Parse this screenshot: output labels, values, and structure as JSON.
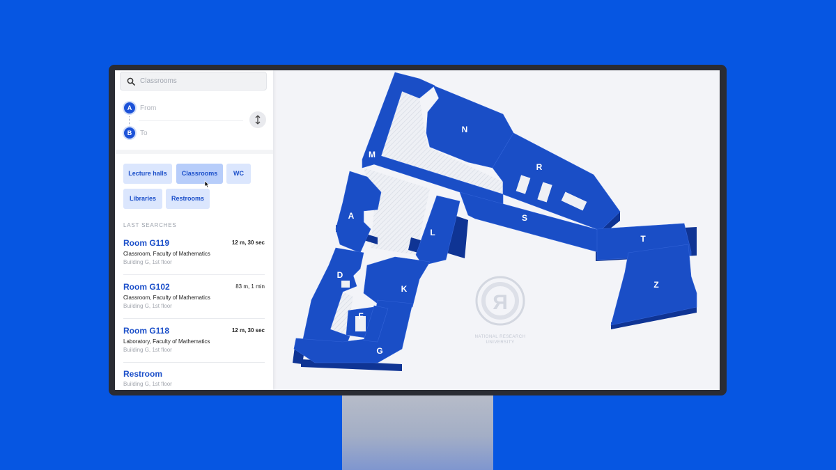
{
  "search": {
    "placeholder": "Classrooms"
  },
  "route": {
    "from_marker": "A",
    "to_marker": "B",
    "from_label": "From",
    "to_label": "To"
  },
  "filters": [
    {
      "label": "Lecture halls",
      "active": false
    },
    {
      "label": "Classrooms",
      "active": true
    },
    {
      "label": "WC",
      "active": false
    },
    {
      "label": "Libraries",
      "active": false
    },
    {
      "label": "Restrooms",
      "active": false
    }
  ],
  "last_searches": {
    "title": "LAST SEARCHES",
    "items": [
      {
        "name": "Room G119",
        "distance": "12 m, 30 sec",
        "description": "Classroom, Faculty of Mathematics",
        "location": "Building G, 1st floor"
      },
      {
        "name": "Room G102",
        "distance": "83 m, 1 min",
        "description": "Classroom, Faculty of Mathematics",
        "location": "Building G, 1st floor"
      },
      {
        "name": "Room G118",
        "distance": "12 m, 30 sec",
        "description": "Laboratory, Faculty of Mathematics",
        "location": "Building G, 1st floor"
      },
      {
        "name": "Restroom",
        "distance": "",
        "description": "",
        "location": "Building G, 1st floor"
      }
    ]
  },
  "map": {
    "buildings": [
      "N",
      "R",
      "M",
      "S",
      "T",
      "Z",
      "A",
      "L",
      "D",
      "K",
      "F",
      "G"
    ],
    "watermark": {
      "line1": "NATIONAL RESEARCH",
      "line2": "UNIVERSITY",
      "logo_letter": "Я"
    }
  },
  "colors": {
    "accent": "#1c4fc8",
    "building_top": "#1a4ec6",
    "building_side": "#0f3494",
    "background": "#0656e2"
  }
}
